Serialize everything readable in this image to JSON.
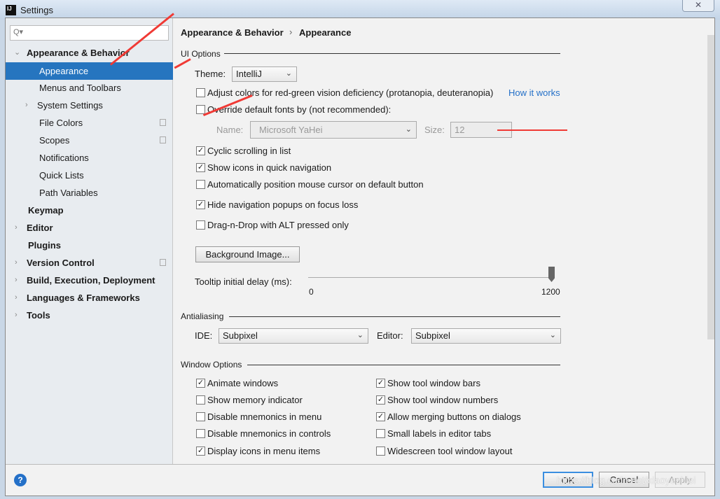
{
  "window": {
    "title": "Settings",
    "app_icon": "IJ",
    "close": "✕"
  },
  "search": {
    "placeholder": "Q▾"
  },
  "sidebar": {
    "items": [
      {
        "label": "Appearance & Behavior",
        "expanded": true
      },
      {
        "label": "Appearance",
        "selected": true
      },
      {
        "label": "Menus and Toolbars"
      },
      {
        "label": "System Settings"
      },
      {
        "label": "File Colors"
      },
      {
        "label": "Scopes"
      },
      {
        "label": "Notifications"
      },
      {
        "label": "Quick Lists"
      },
      {
        "label": "Path Variables"
      },
      {
        "label": "Keymap"
      },
      {
        "label": "Editor"
      },
      {
        "label": "Plugins"
      },
      {
        "label": "Version Control"
      },
      {
        "label": "Build, Execution, Deployment"
      },
      {
        "label": "Languages & Frameworks"
      },
      {
        "label": "Tools"
      }
    ]
  },
  "breadcrumb": {
    "parent": "Appearance & Behavior",
    "sep": "›",
    "current": "Appearance"
  },
  "ui_options": {
    "title": "UI Options",
    "theme_label": "Theme:",
    "theme": "IntelliJ",
    "adjust_colors": {
      "label": "Adjust colors for red-green vision deficiency (protanopia, deuteranopia)",
      "checked": false
    },
    "how_it_works": "How it works",
    "override_fonts": {
      "label": "Override default fonts by (not recommended):",
      "checked": false
    },
    "name_label": "Name:",
    "font_name": "Microsoft YaHei",
    "size_label": "Size:",
    "font_size": "12",
    "checks": [
      {
        "label": "Cyclic scrolling in list",
        "checked": true
      },
      {
        "label": "Show icons in quick navigation",
        "checked": true
      },
      {
        "label": "Automatically position mouse cursor on default button",
        "checked": false
      },
      {
        "label": "Hide navigation popups on focus loss",
        "checked": true
      },
      {
        "label": "Drag-n-Drop with ALT pressed only",
        "checked": false
      }
    ],
    "background_image": "Background Image...",
    "tooltip_label": "Tooltip initial delay (ms):",
    "tooltip_min": "0",
    "tooltip_max": "1200",
    "tooltip_value": 1200
  },
  "antialiasing": {
    "title": "Antialiasing",
    "ide_label": "IDE:",
    "ide": "Subpixel",
    "editor_label": "Editor:",
    "editor": "Subpixel"
  },
  "window_options": {
    "title": "Window Options",
    "left": [
      {
        "label": "Animate windows",
        "checked": true
      },
      {
        "label": "Show memory indicator",
        "checked": false
      },
      {
        "label": "Disable mnemonics in menu",
        "checked": false
      },
      {
        "label": "Disable mnemonics in controls",
        "checked": false
      },
      {
        "label": "Display icons in menu items",
        "checked": true
      }
    ],
    "right": [
      {
        "label": "Show tool window bars",
        "checked": true
      },
      {
        "label": "Show tool window numbers",
        "checked": true
      },
      {
        "label": "Allow merging buttons on dialogs",
        "checked": true
      },
      {
        "label": "Small labels in editor tabs",
        "checked": false
      },
      {
        "label": "Widescreen tool window layout",
        "checked": false
      }
    ]
  },
  "footer": {
    "help": "?",
    "ok": "OK",
    "cancel": "Cancel",
    "apply": "Apply"
  },
  "watermark": "https://blog.csdn.net/xiaoyezhiei",
  "colors": {
    "selection": "#2675bf",
    "link": "#2470c8",
    "annotation_arrow": "#f03a35"
  }
}
